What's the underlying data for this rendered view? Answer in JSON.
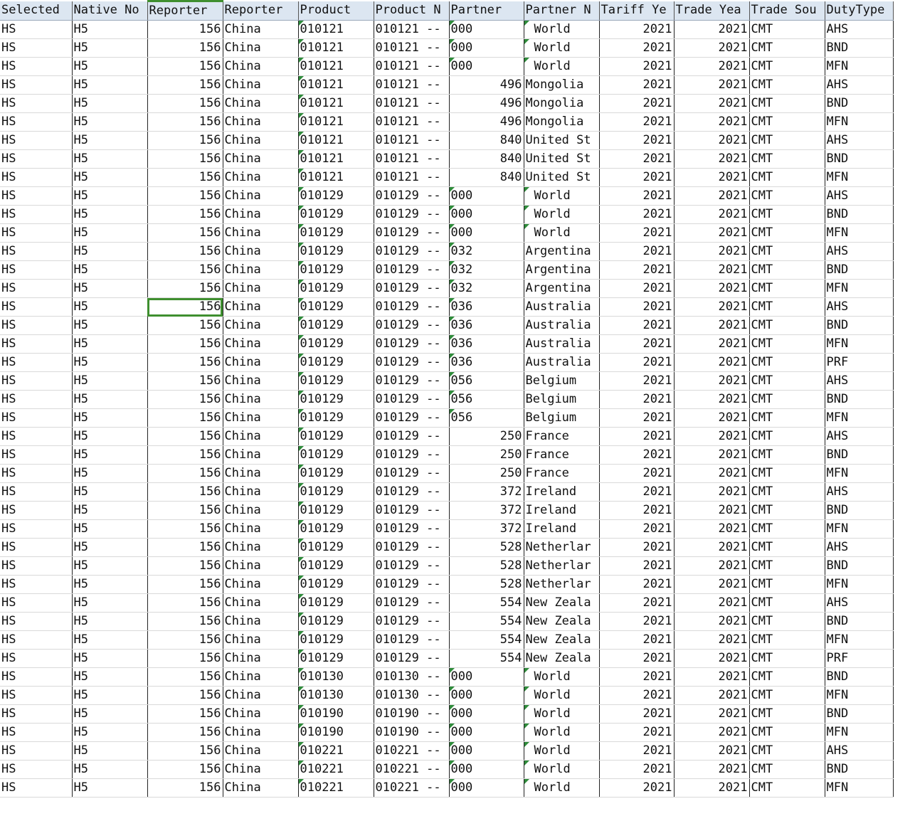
{
  "columns": [
    "Selected",
    "Native No",
    "Reporter",
    "Reporter",
    "Product",
    "Product N",
    "Partner",
    "Partner N",
    "Tariff Ye",
    "Trade Yea",
    "Trade Sou",
    "DutyType"
  ],
  "rows": [
    [
      "HS",
      "H5",
      "156",
      "China",
      "010121",
      "010121 --",
      "000",
      "World",
      "2021",
      "2021",
      "CMT",
      "AHS"
    ],
    [
      "HS",
      "H5",
      "156",
      "China",
      "010121",
      "010121 --",
      "000",
      "World",
      "2021",
      "2021",
      "CMT",
      "BND"
    ],
    [
      "HS",
      "H5",
      "156",
      "China",
      "010121",
      "010121 --",
      "000",
      "World",
      "2021",
      "2021",
      "CMT",
      "MFN"
    ],
    [
      "HS",
      "H5",
      "156",
      "China",
      "010121",
      "010121 --",
      "496",
      "Mongolia",
      "2021",
      "2021",
      "CMT",
      "AHS"
    ],
    [
      "HS",
      "H5",
      "156",
      "China",
      "010121",
      "010121 --",
      "496",
      "Mongolia",
      "2021",
      "2021",
      "CMT",
      "BND"
    ],
    [
      "HS",
      "H5",
      "156",
      "China",
      "010121",
      "010121 --",
      "496",
      "Mongolia",
      "2021",
      "2021",
      "CMT",
      "MFN"
    ],
    [
      "HS",
      "H5",
      "156",
      "China",
      "010121",
      "010121 --",
      "840",
      "United St",
      "2021",
      "2021",
      "CMT",
      "AHS"
    ],
    [
      "HS",
      "H5",
      "156",
      "China",
      "010121",
      "010121 --",
      "840",
      "United St",
      "2021",
      "2021",
      "CMT",
      "BND"
    ],
    [
      "HS",
      "H5",
      "156",
      "China",
      "010121",
      "010121 --",
      "840",
      "United St",
      "2021",
      "2021",
      "CMT",
      "MFN"
    ],
    [
      "HS",
      "H5",
      "156",
      "China",
      "010129",
      "010129 --",
      "000",
      "World",
      "2021",
      "2021",
      "CMT",
      "AHS"
    ],
    [
      "HS",
      "H5",
      "156",
      "China",
      "010129",
      "010129 --",
      "000",
      "World",
      "2021",
      "2021",
      "CMT",
      "BND"
    ],
    [
      "HS",
      "H5",
      "156",
      "China",
      "010129",
      "010129 --",
      "000",
      "World",
      "2021",
      "2021",
      "CMT",
      "MFN"
    ],
    [
      "HS",
      "H5",
      "156",
      "China",
      "010129",
      "010129 --",
      "032",
      "Argentina",
      "2021",
      "2021",
      "CMT",
      "AHS"
    ],
    [
      "HS",
      "H5",
      "156",
      "China",
      "010129",
      "010129 --",
      "032",
      "Argentina",
      "2021",
      "2021",
      "CMT",
      "BND"
    ],
    [
      "HS",
      "H5",
      "156",
      "China",
      "010129",
      "010129 --",
      "032",
      "Argentina",
      "2021",
      "2021",
      "CMT",
      "MFN"
    ],
    [
      "HS",
      "H5",
      "156",
      "China",
      "010129",
      "010129 --",
      "036",
      "Australia",
      "2021",
      "2021",
      "CMT",
      "AHS"
    ],
    [
      "HS",
      "H5",
      "156",
      "China",
      "010129",
      "010129 --",
      "036",
      "Australia",
      "2021",
      "2021",
      "CMT",
      "BND"
    ],
    [
      "HS",
      "H5",
      "156",
      "China",
      "010129",
      "010129 --",
      "036",
      "Australia",
      "2021",
      "2021",
      "CMT",
      "MFN"
    ],
    [
      "HS",
      "H5",
      "156",
      "China",
      "010129",
      "010129 --",
      "036",
      "Australia",
      "2021",
      "2021",
      "CMT",
      "PRF"
    ],
    [
      "HS",
      "H5",
      "156",
      "China",
      "010129",
      "010129 --",
      "056",
      "Belgium",
      "2021",
      "2021",
      "CMT",
      "AHS"
    ],
    [
      "HS",
      "H5",
      "156",
      "China",
      "010129",
      "010129 --",
      "056",
      "Belgium",
      "2021",
      "2021",
      "CMT",
      "BND"
    ],
    [
      "HS",
      "H5",
      "156",
      "China",
      "010129",
      "010129 --",
      "056",
      "Belgium",
      "2021",
      "2021",
      "CMT",
      "MFN"
    ],
    [
      "HS",
      "H5",
      "156",
      "China",
      "010129",
      "010129 --",
      "250",
      "France",
      "2021",
      "2021",
      "CMT",
      "AHS"
    ],
    [
      "HS",
      "H5",
      "156",
      "China",
      "010129",
      "010129 --",
      "250",
      "France",
      "2021",
      "2021",
      "CMT",
      "BND"
    ],
    [
      "HS",
      "H5",
      "156",
      "China",
      "010129",
      "010129 --",
      "250",
      "France",
      "2021",
      "2021",
      "CMT",
      "MFN"
    ],
    [
      "HS",
      "H5",
      "156",
      "China",
      "010129",
      "010129 --",
      "372",
      "Ireland",
      "2021",
      "2021",
      "CMT",
      "AHS"
    ],
    [
      "HS",
      "H5",
      "156",
      "China",
      "010129",
      "010129 --",
      "372",
      "Ireland",
      "2021",
      "2021",
      "CMT",
      "BND"
    ],
    [
      "HS",
      "H5",
      "156",
      "China",
      "010129",
      "010129 --",
      "372",
      "Ireland",
      "2021",
      "2021",
      "CMT",
      "MFN"
    ],
    [
      "HS",
      "H5",
      "156",
      "China",
      "010129",
      "010129 --",
      "528",
      "Netherlar",
      "2021",
      "2021",
      "CMT",
      "AHS"
    ],
    [
      "HS",
      "H5",
      "156",
      "China",
      "010129",
      "010129 --",
      "528",
      "Netherlar",
      "2021",
      "2021",
      "CMT",
      "BND"
    ],
    [
      "HS",
      "H5",
      "156",
      "China",
      "010129",
      "010129 --",
      "528",
      "Netherlar",
      "2021",
      "2021",
      "CMT",
      "MFN"
    ],
    [
      "HS",
      "H5",
      "156",
      "China",
      "010129",
      "010129 --",
      "554",
      "New Zeala",
      "2021",
      "2021",
      "CMT",
      "AHS"
    ],
    [
      "HS",
      "H5",
      "156",
      "China",
      "010129",
      "010129 --",
      "554",
      "New Zeala",
      "2021",
      "2021",
      "CMT",
      "BND"
    ],
    [
      "HS",
      "H5",
      "156",
      "China",
      "010129",
      "010129 --",
      "554",
      "New Zeala",
      "2021",
      "2021",
      "CMT",
      "MFN"
    ],
    [
      "HS",
      "H5",
      "156",
      "China",
      "010129",
      "010129 --",
      "554",
      "New Zeala",
      "2021",
      "2021",
      "CMT",
      "PRF"
    ],
    [
      "HS",
      "H5",
      "156",
      "China",
      "010130",
      "010130 --",
      "000",
      "World",
      "2021",
      "2021",
      "CMT",
      "BND"
    ],
    [
      "HS",
      "H5",
      "156",
      "China",
      "010130",
      "010130 --",
      "000",
      "World",
      "2021",
      "2021",
      "CMT",
      "MFN"
    ],
    [
      "HS",
      "H5",
      "156",
      "China",
      "010190",
      "010190 --",
      "000",
      "World",
      "2021",
      "2021",
      "CMT",
      "BND"
    ],
    [
      "HS",
      "H5",
      "156",
      "China",
      "010190",
      "010190 --",
      "000",
      "World",
      "2021",
      "2021",
      "CMT",
      "MFN"
    ],
    [
      "HS",
      "H5",
      "156",
      "China",
      "010221",
      "010221 --",
      "000",
      "World",
      "2021",
      "2021",
      "CMT",
      "AHS"
    ],
    [
      "HS",
      "H5",
      "156",
      "China",
      "010221",
      "010221 --",
      "000",
      "World",
      "2021",
      "2021",
      "CMT",
      "BND"
    ],
    [
      "HS",
      "H5",
      "156",
      "China",
      "010221",
      "010221 --",
      "000",
      "World",
      "2021",
      "2021",
      "CMT",
      "MFN"
    ]
  ],
  "selected_cell": {
    "row": 15,
    "col": 2
  },
  "colors": {
    "header_bg": "#dce6f1",
    "selection": "#3f8f2f",
    "text_marker": "#2e8b3a"
  }
}
